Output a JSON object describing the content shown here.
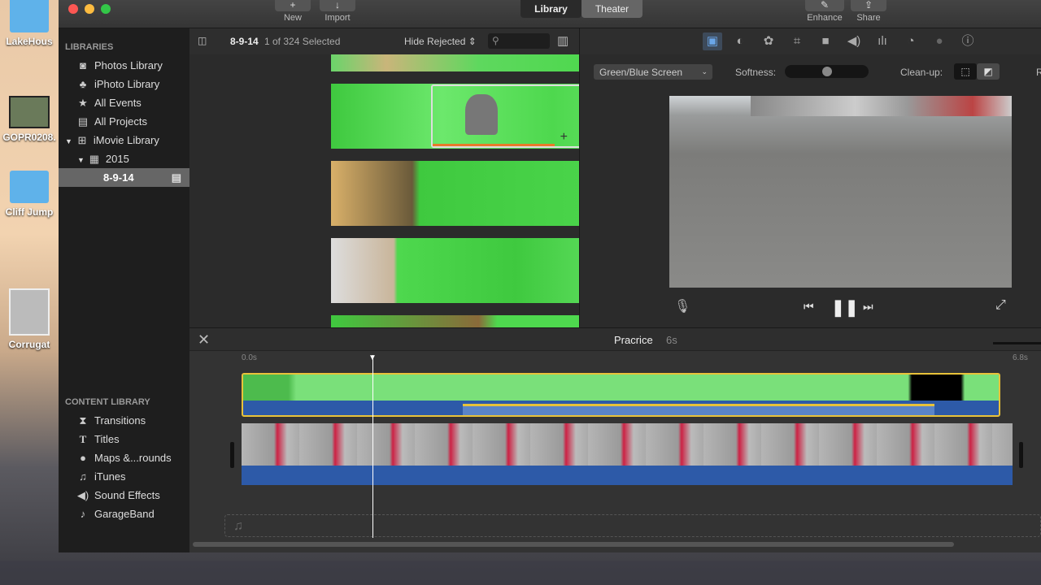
{
  "desktop": {
    "icons": [
      "LakeHous",
      "GOPR0208.",
      "Cliff Jump",
      "Corrugat"
    ]
  },
  "toolbar": {
    "new_label": "New",
    "import_label": "Import",
    "library_tab": "Library",
    "theater_tab": "Theater",
    "enhance_label": "Enhance",
    "share_label": "Share"
  },
  "sidebar": {
    "libraries_heading": "LIBRARIES",
    "items": [
      {
        "label": "Photos Library",
        "icon": "photos-icon"
      },
      {
        "label": "iPhoto Library",
        "icon": "palm-tree-icon"
      },
      {
        "label": "All Events",
        "icon": "star-icon"
      },
      {
        "label": "All Projects",
        "icon": "clapper-icon"
      },
      {
        "label": "iMovie Library",
        "icon": "grid-icon"
      },
      {
        "label": "2015",
        "icon": "calendar-icon"
      },
      {
        "label": "8-9-14",
        "icon": "clapper-icon",
        "selected": true
      }
    ],
    "content_heading": "CONTENT LIBRARY",
    "content_items": [
      {
        "label": "Transitions",
        "icon": "transitions-icon"
      },
      {
        "label": "Titles",
        "icon": "titles-icon"
      },
      {
        "label": "Maps &...rounds",
        "icon": "globe-icon"
      },
      {
        "label": "iTunes",
        "icon": "music-note-icon"
      },
      {
        "label": "Sound Effects",
        "icon": "speaker-icon"
      },
      {
        "label": "GarageBand",
        "icon": "guitar-icon"
      }
    ]
  },
  "browser": {
    "event": "8-9-14",
    "selection": "1 of 324 Selected",
    "filter": "Hide Rejected",
    "search_placeholder": ""
  },
  "viewer": {
    "effect": "Green/Blue Screen",
    "softness_label": "Softness:",
    "softness_value": 0.5,
    "cleanup_label": "Clean-up:",
    "reset_label": "R"
  },
  "timeline": {
    "project": "Pracrice",
    "duration": "6s",
    "start": "0.0s",
    "end": "6.8s"
  },
  "colors": {
    "accent_blue": "#4a90e2",
    "clip_yellow": "#e8c23a",
    "audio_blue": "#2d5aa8"
  }
}
